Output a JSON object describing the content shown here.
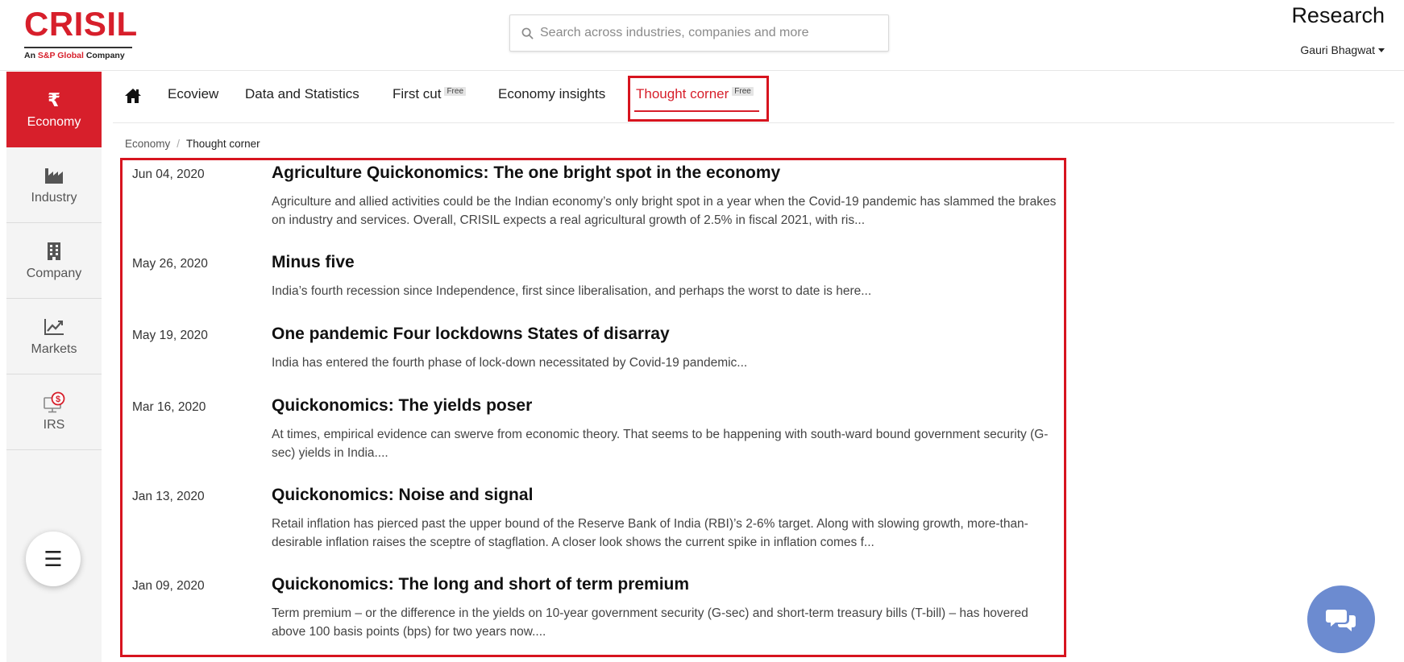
{
  "header": {
    "logo": {
      "word": "CRISIL",
      "tagline_prefix": "An ",
      "tagline_brand": "S&P Global",
      "tagline_suffix": " Company"
    },
    "search": {
      "placeholder": "Search across industries, companies and more"
    },
    "product": "Research",
    "user": "Gauri Bhagwat"
  },
  "sidebar": {
    "items": [
      {
        "label": "Economy",
        "icon": "rupee-icon",
        "glyph": "₹",
        "active": true
      },
      {
        "label": "Industry",
        "icon": "factory-icon",
        "active": false
      },
      {
        "label": "Company",
        "icon": "building-icon",
        "active": false
      },
      {
        "label": "Markets",
        "icon": "line-chart-icon",
        "active": false
      },
      {
        "label": "IRS",
        "icon": "monitor-dollar-icon",
        "active": false
      }
    ],
    "menu_glyph": "☰"
  },
  "nav": {
    "tabs": [
      {
        "label": "Ecoview",
        "badge": ""
      },
      {
        "label": "Data and Statistics",
        "badge": ""
      },
      {
        "label": "First cut",
        "badge": "Free"
      },
      {
        "label": "Economy insights",
        "badge": ""
      },
      {
        "label": "Thought corner",
        "badge": "Free",
        "active": true
      }
    ]
  },
  "breadcrumb": {
    "root": "Economy",
    "separator": "/",
    "current": "Thought corner"
  },
  "articles": [
    {
      "date": "Jun 04, 2020",
      "title": "Agriculture Quickonomics: The one bright spot in the economy",
      "summary": "Agriculture and allied activities could be the Indian economy’s only bright spot in a year when the Covid-19 pandemic has slammed the brakes on industry and services. Overall, CRISIL expects a real agricultural growth of 2.5% in fiscal 2021, with ris..."
    },
    {
      "date": "May 26, 2020",
      "title": "Minus five",
      "summary": "India’s fourth recession since Independence, first since liberalisation, and perhaps the worst to date is here..."
    },
    {
      "date": "May 19, 2020",
      "title": "One pandemic Four lockdowns States of disarray",
      "summary": "India has entered the fourth phase of lock-down necessitated by Covid-19 pandemic..."
    },
    {
      "date": "Mar 16, 2020",
      "title": "Quickonomics: The yields poser",
      "summary": "At times, empirical evidence can swerve from economic theory. That seems to be happening with south-ward bound government security (G-sec) yields in India...."
    },
    {
      "date": "Jan 13, 2020",
      "title": "Quickonomics: Noise and signal",
      "summary": "Retail inflation has pierced past the upper bound of the Reserve Bank of India (RBI)’s 2-6% target. Along with slowing growth, more-than-desirable inflation raises the sceptre of stagflation. A closer look shows the current spike in inflation comes f..."
    },
    {
      "date": "Jan 09, 2020",
      "title": "Quickonomics: The long and short of term premium",
      "summary": "Term premium – or the difference in the yields on 10-year government security (G-sec) and short-term treasury bills (T-bill) – has hovered above 100 basis points (bps) for two years now...."
    }
  ],
  "colors": {
    "brand_red": "#d71f2b",
    "annotation_red": "#d7141f",
    "chat_blue": "#6c8bd0",
    "sidebar_bg": "#f4f4f4"
  }
}
